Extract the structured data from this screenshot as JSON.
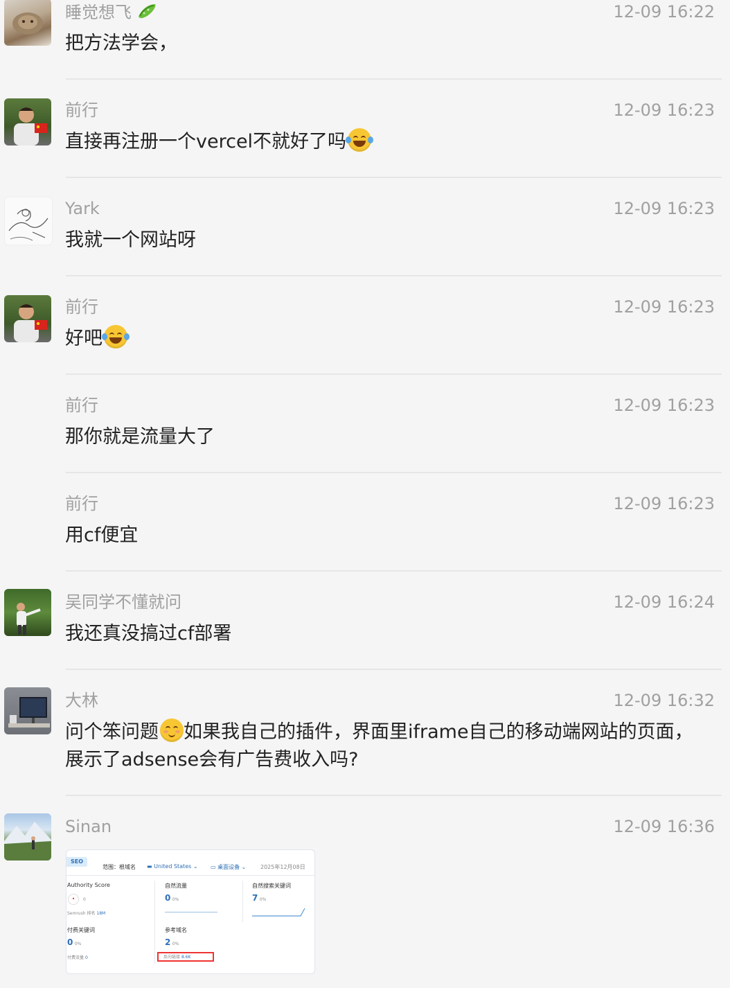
{
  "messages": [
    {
      "name": "睡觉想飞",
      "time": "12-09 16:22",
      "text": "把方法学会，"
    },
    {
      "name": "前行",
      "time": "12-09 16:23",
      "text": "直接再注册一个vercel不就好了吗"
    },
    {
      "name": "Yark",
      "time": "12-09 16:23",
      "text": "我就一个网站呀"
    },
    {
      "name": "前行",
      "time": "12-09 16:23",
      "text": "好吧"
    },
    {
      "name": "前行",
      "time": "12-09 16:23",
      "text": "那你就是流量大了"
    },
    {
      "name": "前行",
      "time": "12-09 16:23",
      "text": "用cf便宜"
    },
    {
      "name": "吴同学不懂就问",
      "time": "12-09 16:24",
      "text": "我还真没搞过cf部署"
    },
    {
      "name": "大林",
      "time": "12-09 16:32",
      "text_a": "问个笨问题",
      "text_b": "如果我自己的插件，界面里iframe自己的移动端网站的页面，展示了adsense会有广告费收入吗?"
    },
    {
      "name": "Sinan",
      "time": "12-09 16:36"
    }
  ],
  "emoji": {
    "laugh_tears": "face-with-tears-of-joy-icon",
    "blush_smile": "smiling-face-icon",
    "cucumber": "cucumber-icon"
  },
  "seo_card": {
    "tag": "SEO",
    "scope": "范围：根域名",
    "country": "United States",
    "device": "桌面设备",
    "date": "2025年12月08日",
    "authority_label": "Authority Score",
    "authority_value": "0",
    "semrush_rank_label": "Semrush 排名",
    "semrush_rank_value": "18M",
    "organic_traffic_label": "自然流量",
    "organic_traffic_value": "0",
    "organic_traffic_pct": "0%",
    "organic_kw_label": "自然搜索关键词",
    "organic_kw_value": "7",
    "organic_kw_pct": "0%",
    "paid_kw_label": "付费关键词",
    "paid_kw_value": "0",
    "paid_kw_pct": "0%",
    "paid_traffic_label": "付费流量",
    "paid_traffic_value": "0",
    "ref_domains_label": "参考域名",
    "ref_domains_value": "2",
    "ref_domains_pct": "0%",
    "backlinks_label": "反向链接",
    "backlinks_value": "8.6K"
  },
  "colors": {
    "name": "#a0a0a0",
    "text": "#222222",
    "background": "#f5f5f5",
    "accent": "#2f6fb5",
    "highlight": "#e33333"
  }
}
